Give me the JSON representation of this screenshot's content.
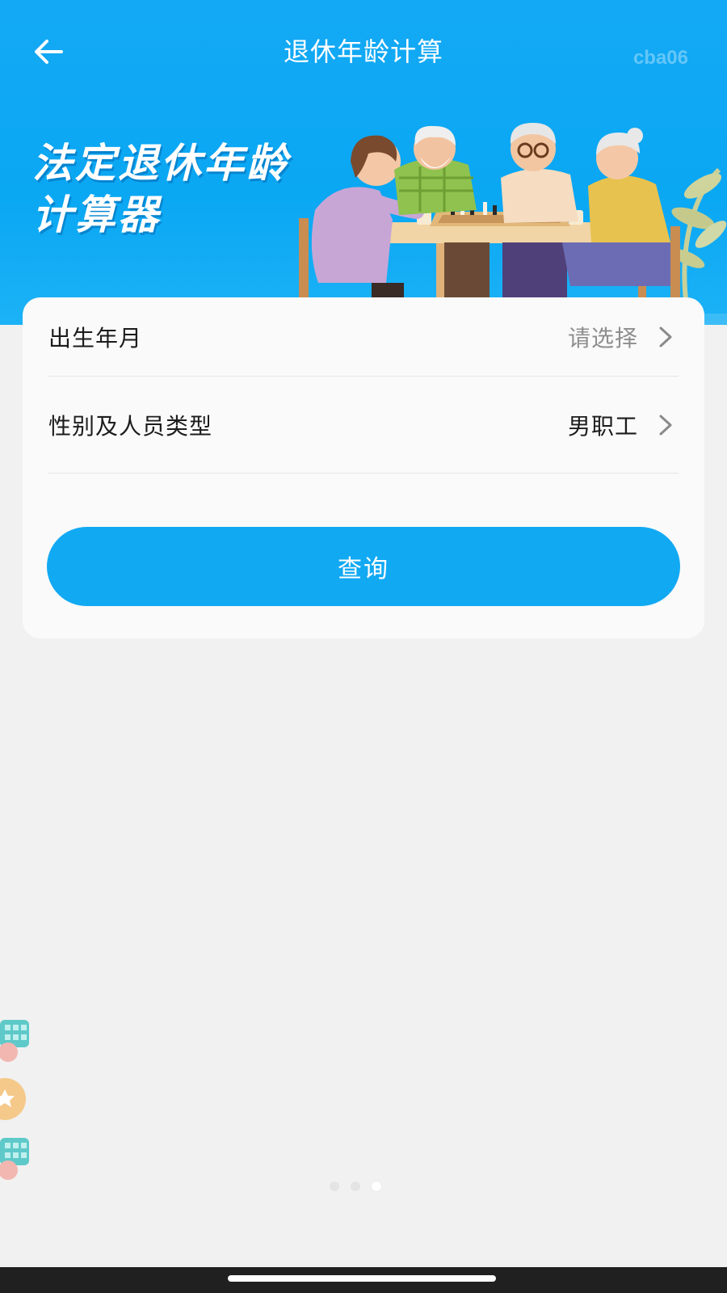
{
  "header": {
    "title": "退休年龄计算",
    "back_icon": "arrow-left-icon",
    "watermark": "cba06"
  },
  "banner": {
    "headline_line1": "法定退休年龄",
    "headline_line2": "计算器",
    "illustration": "elderly-people-playing-chess-illustration"
  },
  "form": {
    "birth": {
      "label": "出生年月",
      "value": "请选择"
    },
    "type": {
      "label": "性别及人员类型",
      "value": "男职工"
    },
    "submit_label": "查询"
  },
  "pager": {
    "count": 3,
    "active": 2
  },
  "colors": {
    "primary": "#12a9f3",
    "background": "#f1f1f1",
    "card": "#fafafa",
    "placeholder": "#8e8e8e"
  }
}
